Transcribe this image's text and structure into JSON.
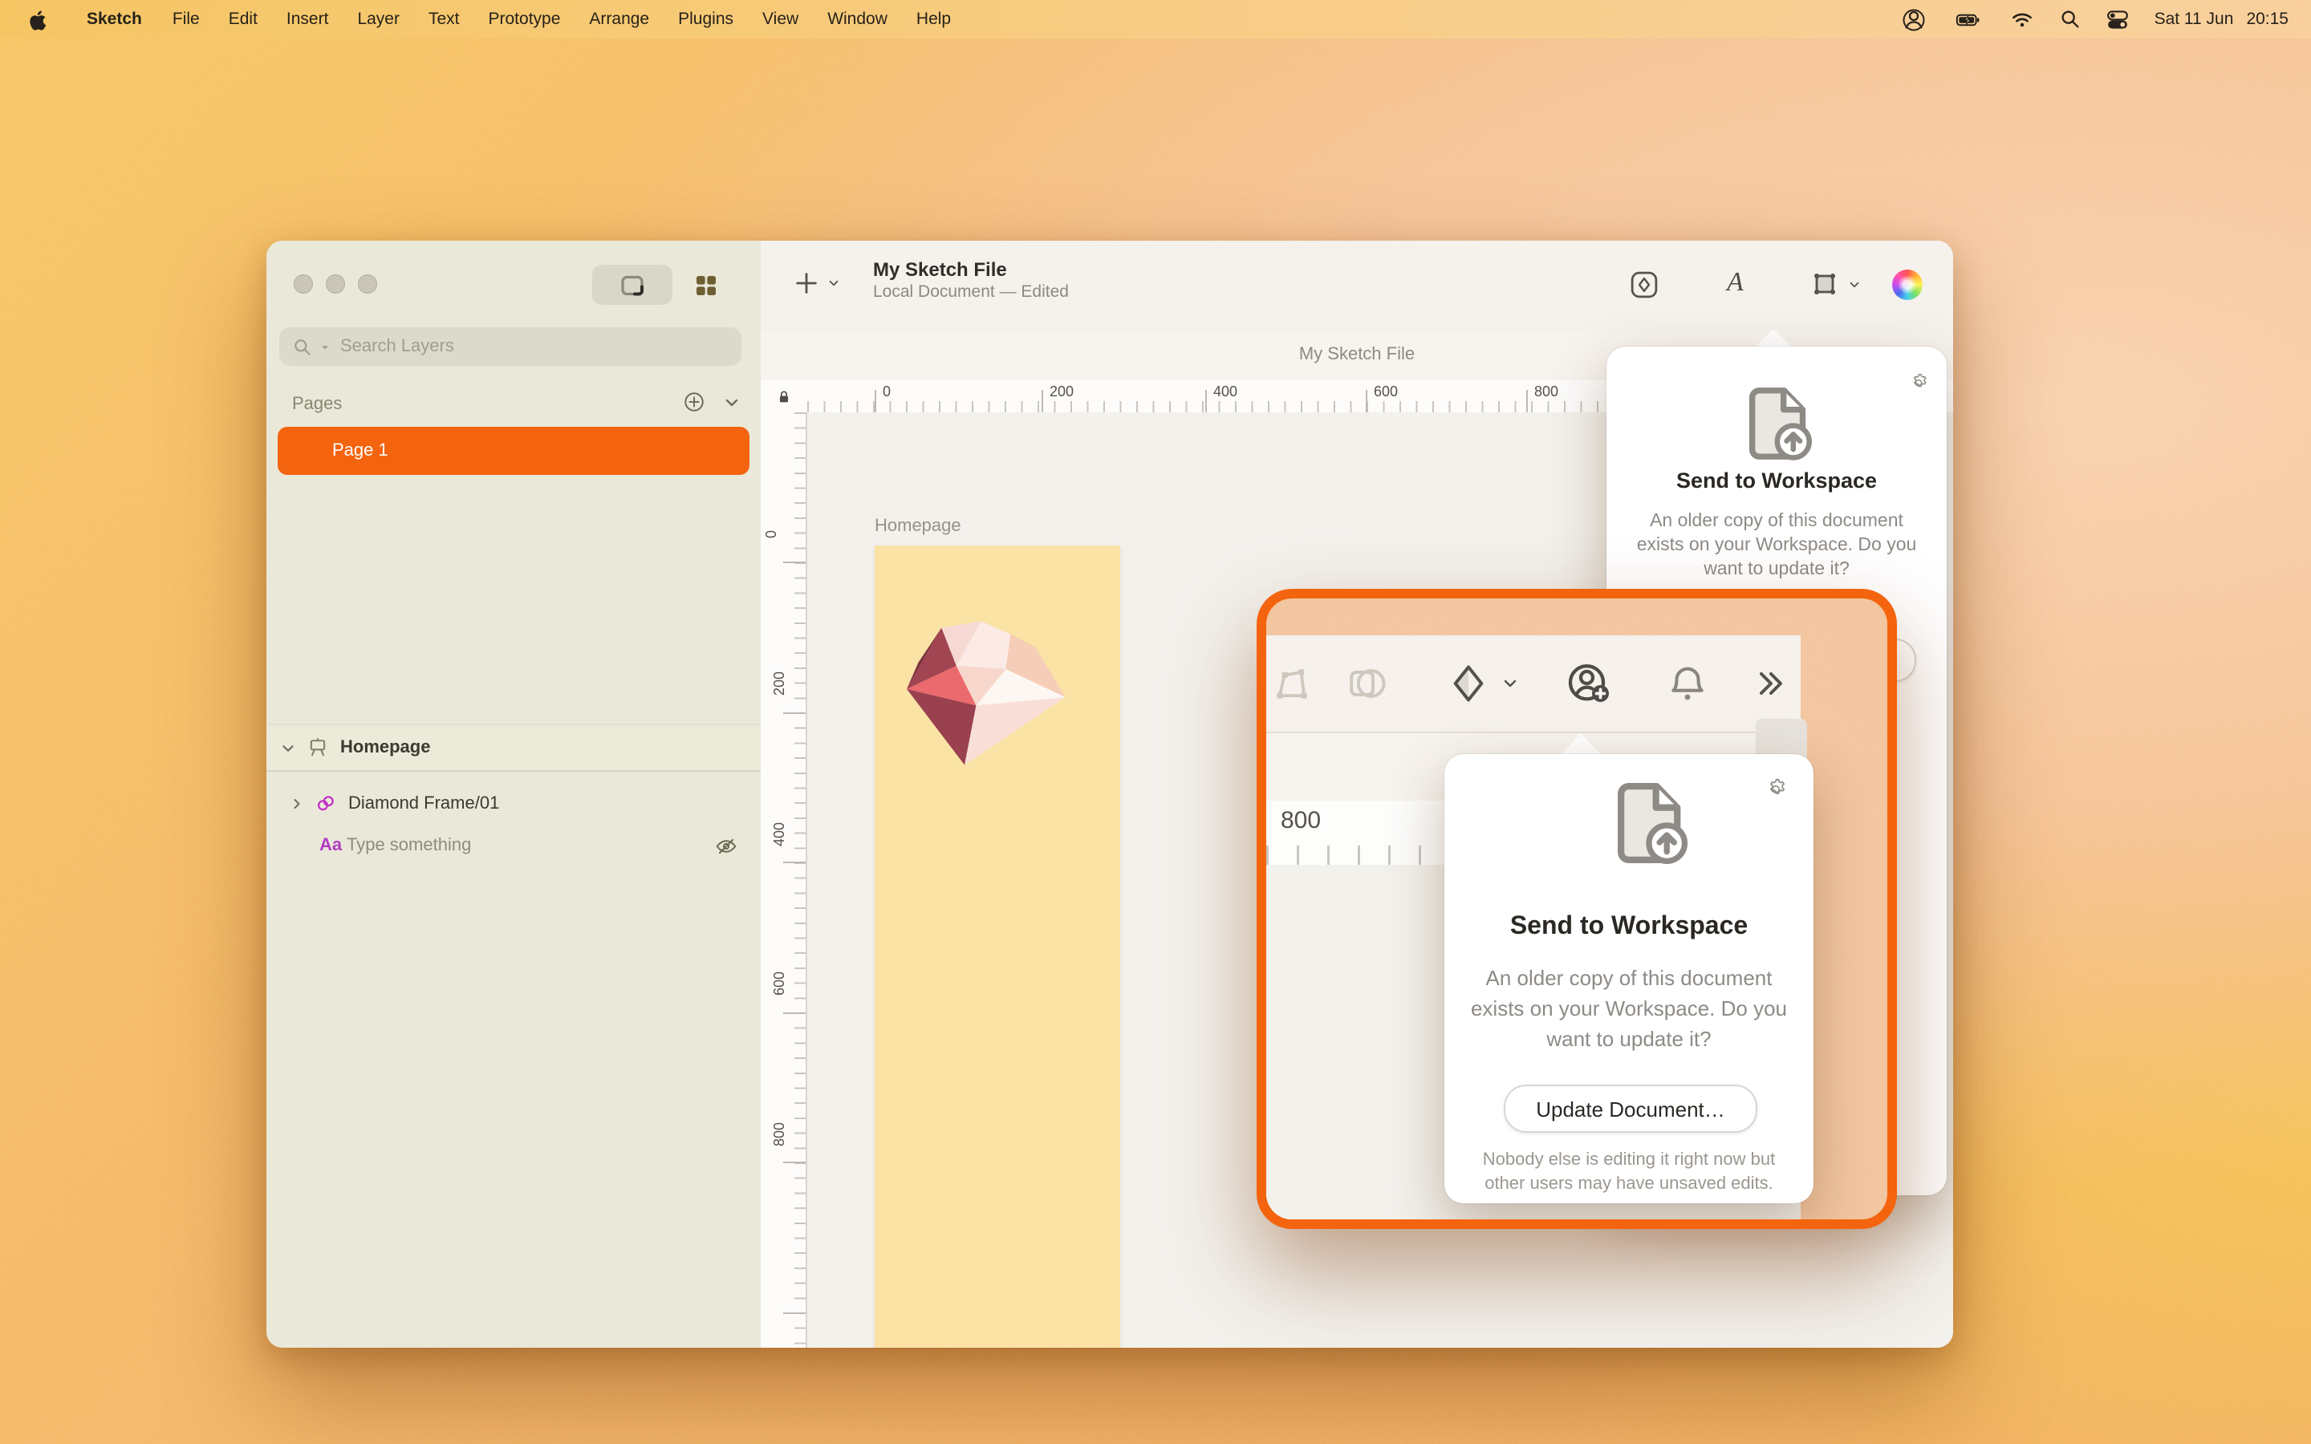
{
  "menu": {
    "items": [
      "Sketch",
      "File",
      "Edit",
      "Insert",
      "Layer",
      "Text",
      "Prototype",
      "Arrange",
      "Plugins",
      "View",
      "Window",
      "Help"
    ],
    "status": {
      "date": "Sat 11 Jun",
      "time": "20:15"
    }
  },
  "sidebar": {
    "search_placeholder": "Search Layers",
    "pages_label": "Pages",
    "page1": "Page 1",
    "layers_header": "Homepage",
    "layer1": "Diamond Frame/01",
    "layer2": "Type something"
  },
  "toolbar": {
    "doc_title": "My Sketch File",
    "doc_status": "Local Document — Edited",
    "text_tool": "A"
  },
  "canvas": {
    "floating_title": "My Sketch File",
    "artboard_label": "Homepage",
    "h_ruler": [
      "0",
      "200",
      "400",
      "600",
      "800"
    ],
    "v_ruler": [
      "0",
      "200",
      "400",
      "600",
      "800"
    ]
  },
  "workspace_popover": {
    "title": "Send to Workspace",
    "body": [
      "An older copy of this document",
      "exists on your Workspace. Do you",
      "want to update it?"
    ],
    "button": "Update Document…",
    "footnote": [
      "Nobody else is editing it right now but",
      "other users may have unsaved edits."
    ]
  },
  "inset": {
    "ruler_label": "800"
  },
  "colors": {
    "accent": "#F4640E",
    "artboard": "#FBE3A6",
    "symbol": "#C030C8",
    "menubar_tint": "#F6C664"
  }
}
